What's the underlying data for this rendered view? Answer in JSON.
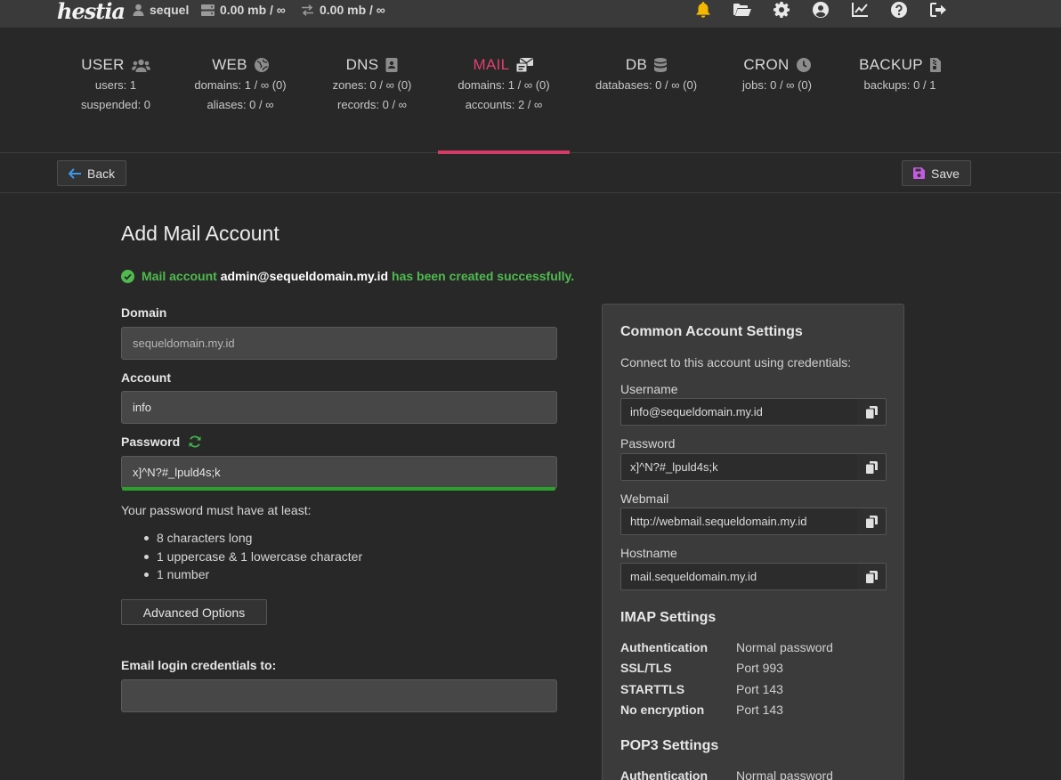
{
  "app": {
    "logo": "hestia"
  },
  "topbar": {
    "user": "sequel",
    "disk": "0.00 mb / ∞",
    "bandwidth": "0.00 mb / ∞"
  },
  "nav": {
    "tabs": [
      {
        "name": "USER",
        "stats": [
          "users: 1",
          "suspended: 0"
        ]
      },
      {
        "name": "WEB",
        "stats": [
          "domains: 1 / ∞ (0)",
          "aliases: 0 / ∞"
        ]
      },
      {
        "name": "DNS",
        "stats": [
          "zones: 0 / ∞ (0)",
          "records: 0 / ∞"
        ]
      },
      {
        "name": "MAIL",
        "stats": [
          "domains: 1 / ∞ (0)",
          "accounts: 2 / ∞"
        ]
      },
      {
        "name": "DB",
        "stats": [
          "databases: 0 / ∞ (0)"
        ]
      },
      {
        "name": "CRON",
        "stats": [
          "jobs: 0 / ∞ (0)"
        ]
      },
      {
        "name": "BACKUP",
        "stats": [
          "backups: 0 / 1"
        ]
      }
    ]
  },
  "toolbar": {
    "back_label": "Back",
    "save_label": "Save"
  },
  "form": {
    "title": "Add Mail Account",
    "alert": {
      "prefix": "Mail account",
      "account": "admin@sequeldomain.my.id",
      "suffix": "has been created successfully."
    },
    "domain_label": "Domain",
    "domain_value": "sequeldomain.my.id",
    "account_label": "Account",
    "account_value": "info",
    "password_label": "Password",
    "password_value": "x]^N?#_lpuld4s;k",
    "password_strength": 1.0,
    "requirements_title": "Your password must have at least:",
    "requirements": [
      "8 characters long",
      "1 uppercase & 1 lowercase character",
      "1 number"
    ],
    "advanced_label": "Advanced Options",
    "email_credentials_label": "Email login credentials to:",
    "email_credentials_value": ""
  },
  "panel": {
    "common_title": "Common Account Settings",
    "common_sub": "Connect to this account using credentials:",
    "username_label": "Username",
    "username_value": "info@sequeldomain.my.id",
    "password_label": "Password",
    "password_value": "x]^N?#_lpuld4s;k",
    "webmail_label": "Webmail",
    "webmail_value": "http://webmail.sequeldomain.my.id",
    "hostname_label": "Hostname",
    "hostname_value": "mail.sequeldomain.my.id",
    "imap_title": "IMAP Settings",
    "imap": [
      {
        "k": "Authentication",
        "v": "Normal password"
      },
      {
        "k": "SSL/TLS",
        "v": "Port 993"
      },
      {
        "k": "STARTTLS",
        "v": "Port 143"
      },
      {
        "k": "No encryption",
        "v": "Port 143"
      }
    ],
    "pop3_title": "POP3 Settings",
    "pop3": [
      {
        "k": "Authentication",
        "v": "Normal password"
      }
    ]
  },
  "colors": {
    "accent": "#d63a66",
    "success": "#4fbb4f",
    "bell": "#f5b800"
  },
  "icons": [
    "user-icon",
    "disk-icon",
    "bandwidth-icon",
    "bell-icon",
    "folder-icon",
    "gear-icon",
    "account-icon",
    "stats-icon",
    "help-icon",
    "logout-icon",
    "users-icon",
    "globe-icon",
    "address-book-icon",
    "mail-icon",
    "database-icon",
    "clock-icon",
    "archive-icon",
    "arrow-left-icon",
    "floppy-icon",
    "check-circle-icon",
    "refresh-icon",
    "copy-icon"
  ]
}
